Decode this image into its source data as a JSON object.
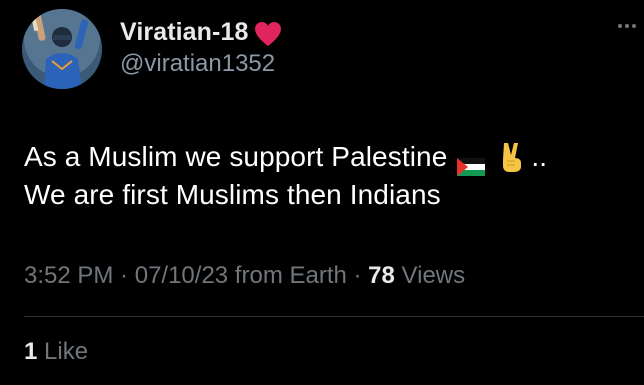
{
  "author": {
    "display_name": "Viratian-18",
    "handle": "@viratian1352",
    "name_emoji_icon": "red-heart-icon",
    "avatar_icon": "avatar"
  },
  "more_icon": "more-options-icon",
  "tweet": {
    "line1": "As a Muslim we support Palestine",
    "line1_emojis": [
      "palestine-flag-icon",
      "victory-hand-icon"
    ],
    "line1_suffix": "..",
    "line2": "We are first Muslims then Indians"
  },
  "meta": {
    "time": "3:52 PM",
    "sep1": " · ",
    "date": "07/10/23",
    "source": " from Earth",
    "sep2": " · ",
    "views_count": "78",
    "views_label": " Views"
  },
  "engagement": {
    "likes_count": "1",
    "likes_label": " Like"
  },
  "colors": {
    "background": "#000000",
    "primary_text": "#e7e9ea",
    "secondary_text": "#71767b",
    "divider": "#2f3336",
    "heart": "#e0245e"
  }
}
